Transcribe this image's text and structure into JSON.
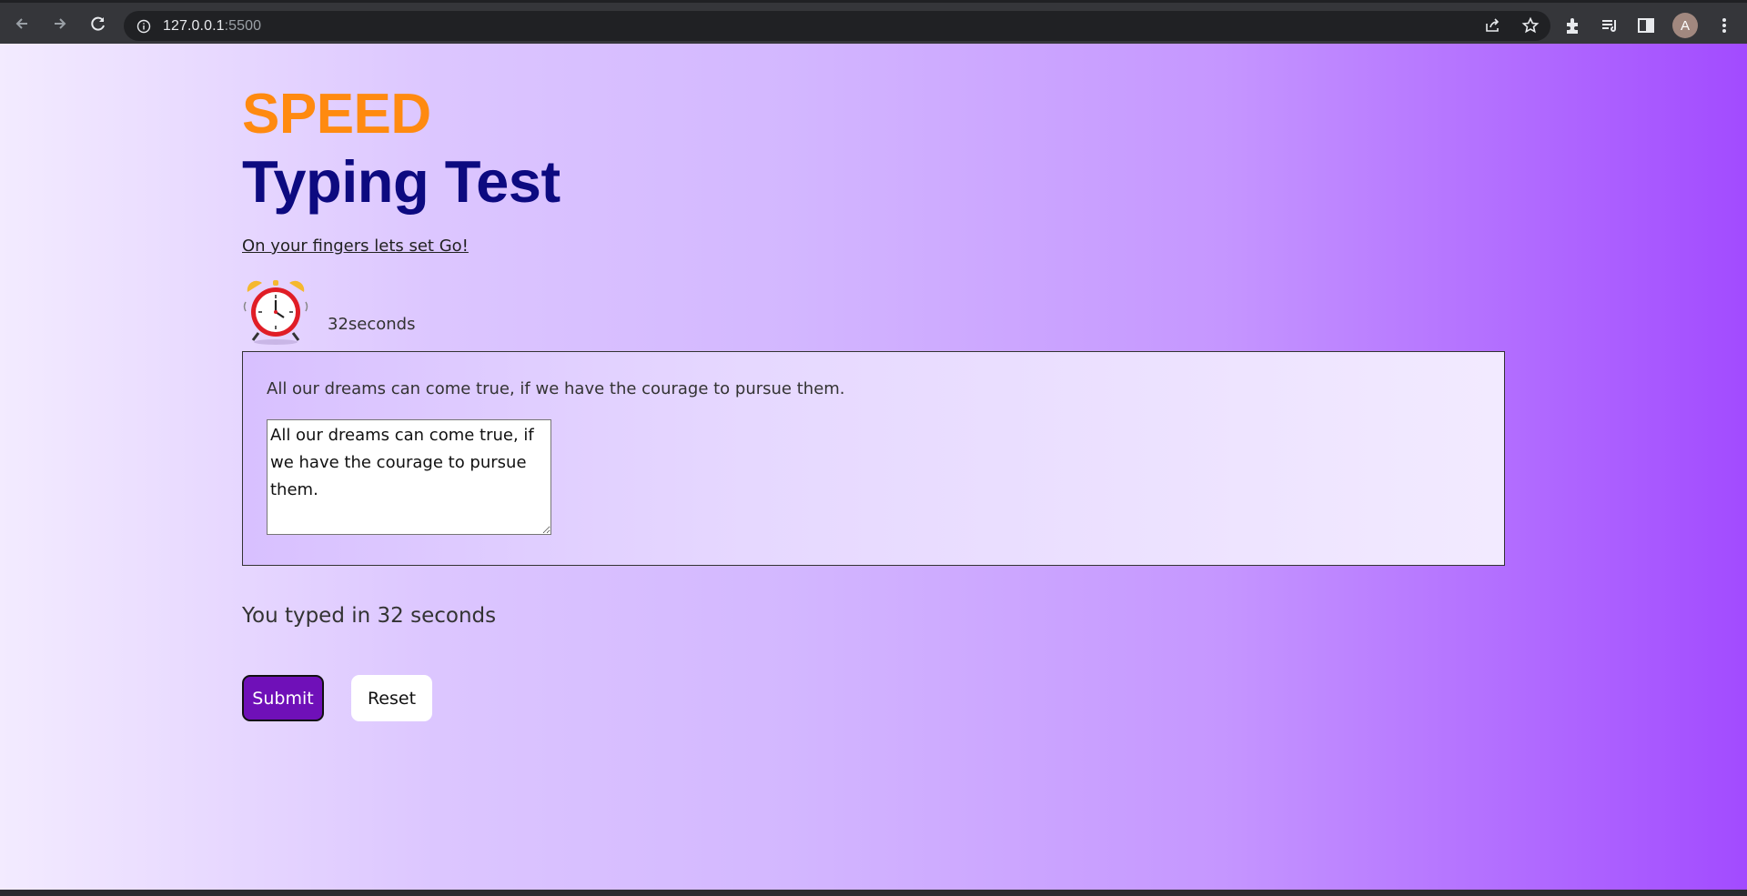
{
  "browser": {
    "url_host": "127.0.0.1",
    "url_port": ":5500",
    "profile_initial": "A"
  },
  "page": {
    "title_speed": "SPEED",
    "title_main": "Typing Test",
    "tagline": "On your fingers lets set Go!",
    "timer_text": "32seconds",
    "quote": "All our dreams can come true, if we have the courage to pursue them.",
    "typed_text": "All our dreams can come true, if we have the courage to pursue them.",
    "result_text": "You typed in 32 seconds",
    "submit_label": "Submit",
    "reset_label": "Reset"
  },
  "colors": {
    "speed": "#ff8a10",
    "title": "#0d0a80",
    "submit_bg": "#6f10b8",
    "gradient_end": "#a24bff"
  },
  "icons": [
    "back-icon",
    "forward-icon",
    "reload-icon",
    "info-icon",
    "share-icon",
    "star-icon",
    "extensions-icon",
    "reading-list-icon",
    "side-panel-icon",
    "avatar",
    "menu-icon",
    "alarm-clock-icon"
  ]
}
